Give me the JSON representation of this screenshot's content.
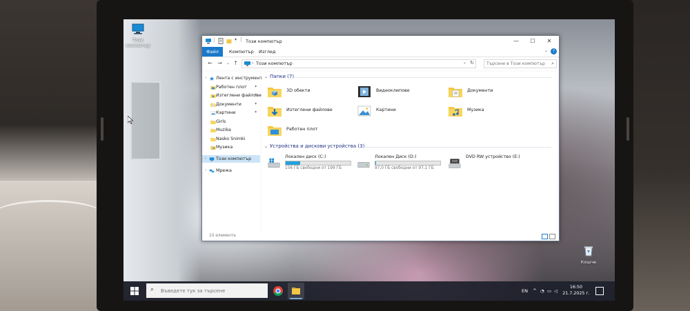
{
  "desktop": {
    "this_pc_icon_label": "Този компютър",
    "recycle_bin_label": "Кошче"
  },
  "window": {
    "title": "Този компютър",
    "ribbon_tabs": [
      "Файл",
      "Компютър",
      "Изглед"
    ],
    "address": "Този компютър",
    "search_placeholder": "Търсене в Този компютър",
    "status": "10 елемента"
  },
  "nav_pane": {
    "items": [
      {
        "label": "Лента с инструменти",
        "icon": "star-icon",
        "pinned": false
      },
      {
        "label": "Работен плот",
        "icon": "desktop-folder-icon",
        "pinned": true
      },
      {
        "label": "Изтеглени файлове",
        "icon": "download-icon",
        "pinned": true
      },
      {
        "label": "Документи",
        "icon": "documents-icon",
        "pinned": true
      },
      {
        "label": "Картини",
        "icon": "pictures-icon",
        "pinned": true
      },
      {
        "label": "Girls",
        "icon": "folder-icon",
        "pinned": false
      },
      {
        "label": "Muzika",
        "icon": "folder-icon",
        "pinned": false
      },
      {
        "label": "Nasko Snimki",
        "icon": "folder-icon",
        "pinned": false
      },
      {
        "label": "Музика",
        "icon": "music-icon",
        "pinned": false
      },
      {
        "label": "Този компютър",
        "icon": "pc-icon",
        "pinned": false,
        "selected": true
      },
      {
        "label": "Мрежа",
        "icon": "network-icon",
        "pinned": false
      }
    ]
  },
  "folders": {
    "header": "Папки (7)",
    "items": [
      {
        "label": "3D обекти",
        "icon": "3d-objects-icon"
      },
      {
        "label": "Видеоклипове",
        "icon": "videos-icon"
      },
      {
        "label": "Документи",
        "icon": "documents-icon"
      },
      {
        "label": "Изтеглени файлове",
        "icon": "download-icon"
      },
      {
        "label": "Картини",
        "icon": "pictures-icon"
      },
      {
        "label": "Музика",
        "icon": "music-icon"
      },
      {
        "label": "Работен плот",
        "icon": "desktop-folder-icon"
      }
    ]
  },
  "drives": {
    "header": "Устройства и дискови устройства (3)",
    "items": [
      {
        "label": "Локален диск (C:)",
        "free_text": "156 ГБ свободни от 199 ГБ",
        "used_fraction": 0.22,
        "icon": "windows-drive-icon"
      },
      {
        "label": "Локален Диск (D:)",
        "free_text": "97,0 ГБ свободни от 97,1 ГБ",
        "used_fraction": 0.01,
        "icon": "drive-icon"
      },
      {
        "label": "DVD RW устройство (E:)",
        "free_text": "",
        "used_fraction": null,
        "icon": "dvd-drive-icon"
      }
    ]
  },
  "taskbar": {
    "search_placeholder": "Въведете тук за търсене",
    "language": "EN",
    "time": "16:50",
    "date": "21.7.2025 г."
  },
  "colors": {
    "accent": "#1979ca",
    "selection": "#cce4f7",
    "drive_fill": "#26a0da",
    "folder_yellow": "#f3c745",
    "taskbar": "#1e202c"
  }
}
